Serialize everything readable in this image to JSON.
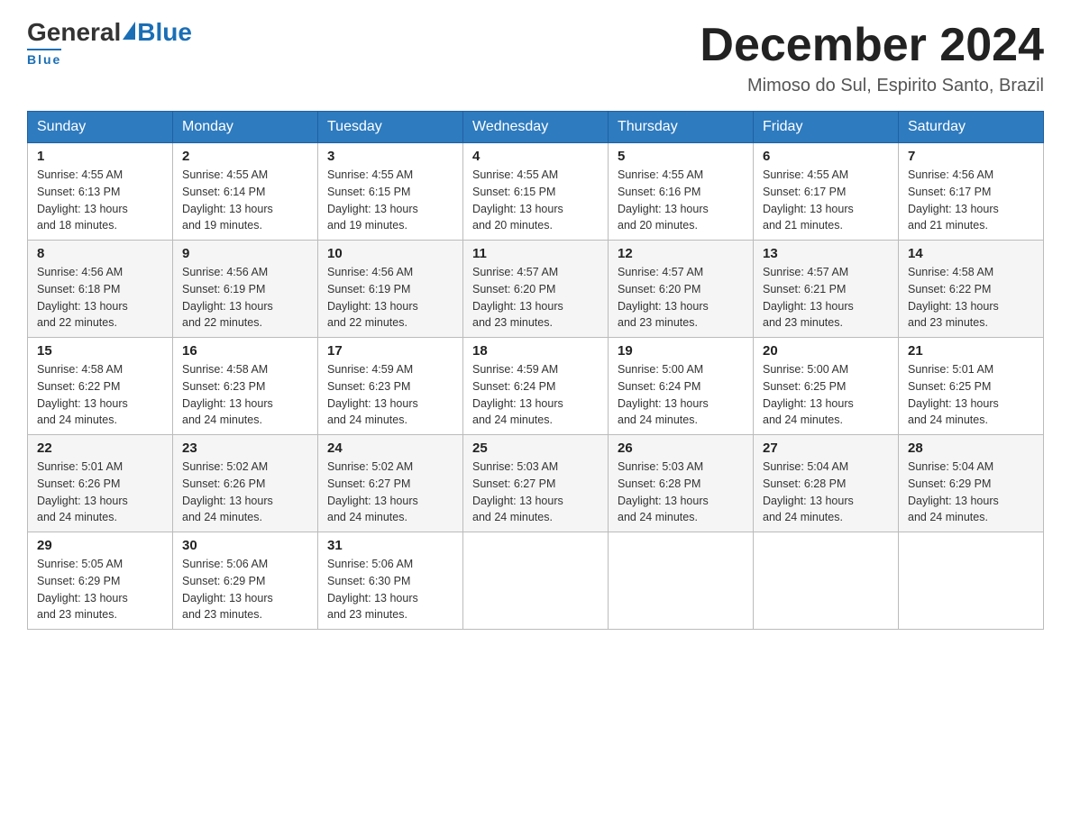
{
  "logo": {
    "general": "General",
    "blue": "Blue",
    "underline": "Blue"
  },
  "title": "December 2024",
  "subtitle": "Mimoso do Sul, Espirito Santo, Brazil",
  "days_of_week": [
    "Sunday",
    "Monday",
    "Tuesday",
    "Wednesday",
    "Thursday",
    "Friday",
    "Saturday"
  ],
  "weeks": [
    [
      {
        "day": "1",
        "sunrise": "4:55 AM",
        "sunset": "6:13 PM",
        "daylight": "13 hours and 18 minutes."
      },
      {
        "day": "2",
        "sunrise": "4:55 AM",
        "sunset": "6:14 PM",
        "daylight": "13 hours and 19 minutes."
      },
      {
        "day": "3",
        "sunrise": "4:55 AM",
        "sunset": "6:15 PM",
        "daylight": "13 hours and 19 minutes."
      },
      {
        "day": "4",
        "sunrise": "4:55 AM",
        "sunset": "6:15 PM",
        "daylight": "13 hours and 20 minutes."
      },
      {
        "day": "5",
        "sunrise": "4:55 AM",
        "sunset": "6:16 PM",
        "daylight": "13 hours and 20 minutes."
      },
      {
        "day": "6",
        "sunrise": "4:55 AM",
        "sunset": "6:17 PM",
        "daylight": "13 hours and 21 minutes."
      },
      {
        "day": "7",
        "sunrise": "4:56 AM",
        "sunset": "6:17 PM",
        "daylight": "13 hours and 21 minutes."
      }
    ],
    [
      {
        "day": "8",
        "sunrise": "4:56 AM",
        "sunset": "6:18 PM",
        "daylight": "13 hours and 22 minutes."
      },
      {
        "day": "9",
        "sunrise": "4:56 AM",
        "sunset": "6:19 PM",
        "daylight": "13 hours and 22 minutes."
      },
      {
        "day": "10",
        "sunrise": "4:56 AM",
        "sunset": "6:19 PM",
        "daylight": "13 hours and 22 minutes."
      },
      {
        "day": "11",
        "sunrise": "4:57 AM",
        "sunset": "6:20 PM",
        "daylight": "13 hours and 23 minutes."
      },
      {
        "day": "12",
        "sunrise": "4:57 AM",
        "sunset": "6:20 PM",
        "daylight": "13 hours and 23 minutes."
      },
      {
        "day": "13",
        "sunrise": "4:57 AM",
        "sunset": "6:21 PM",
        "daylight": "13 hours and 23 minutes."
      },
      {
        "day": "14",
        "sunrise": "4:58 AM",
        "sunset": "6:22 PM",
        "daylight": "13 hours and 23 minutes."
      }
    ],
    [
      {
        "day": "15",
        "sunrise": "4:58 AM",
        "sunset": "6:22 PM",
        "daylight": "13 hours and 24 minutes."
      },
      {
        "day": "16",
        "sunrise": "4:58 AM",
        "sunset": "6:23 PM",
        "daylight": "13 hours and 24 minutes."
      },
      {
        "day": "17",
        "sunrise": "4:59 AM",
        "sunset": "6:23 PM",
        "daylight": "13 hours and 24 minutes."
      },
      {
        "day": "18",
        "sunrise": "4:59 AM",
        "sunset": "6:24 PM",
        "daylight": "13 hours and 24 minutes."
      },
      {
        "day": "19",
        "sunrise": "5:00 AM",
        "sunset": "6:24 PM",
        "daylight": "13 hours and 24 minutes."
      },
      {
        "day": "20",
        "sunrise": "5:00 AM",
        "sunset": "6:25 PM",
        "daylight": "13 hours and 24 minutes."
      },
      {
        "day": "21",
        "sunrise": "5:01 AM",
        "sunset": "6:25 PM",
        "daylight": "13 hours and 24 minutes."
      }
    ],
    [
      {
        "day": "22",
        "sunrise": "5:01 AM",
        "sunset": "6:26 PM",
        "daylight": "13 hours and 24 minutes."
      },
      {
        "day": "23",
        "sunrise": "5:02 AM",
        "sunset": "6:26 PM",
        "daylight": "13 hours and 24 minutes."
      },
      {
        "day": "24",
        "sunrise": "5:02 AM",
        "sunset": "6:27 PM",
        "daylight": "13 hours and 24 minutes."
      },
      {
        "day": "25",
        "sunrise": "5:03 AM",
        "sunset": "6:27 PM",
        "daylight": "13 hours and 24 minutes."
      },
      {
        "day": "26",
        "sunrise": "5:03 AM",
        "sunset": "6:28 PM",
        "daylight": "13 hours and 24 minutes."
      },
      {
        "day": "27",
        "sunrise": "5:04 AM",
        "sunset": "6:28 PM",
        "daylight": "13 hours and 24 minutes."
      },
      {
        "day": "28",
        "sunrise": "5:04 AM",
        "sunset": "6:29 PM",
        "daylight": "13 hours and 24 minutes."
      }
    ],
    [
      {
        "day": "29",
        "sunrise": "5:05 AM",
        "sunset": "6:29 PM",
        "daylight": "13 hours and 23 minutes."
      },
      {
        "day": "30",
        "sunrise": "5:06 AM",
        "sunset": "6:29 PM",
        "daylight": "13 hours and 23 minutes."
      },
      {
        "day": "31",
        "sunrise": "5:06 AM",
        "sunset": "6:30 PM",
        "daylight": "13 hours and 23 minutes."
      },
      null,
      null,
      null,
      null
    ]
  ],
  "labels": {
    "sunrise_prefix": "Sunrise: ",
    "sunset_prefix": "Sunset: ",
    "daylight_prefix": "Daylight: "
  }
}
